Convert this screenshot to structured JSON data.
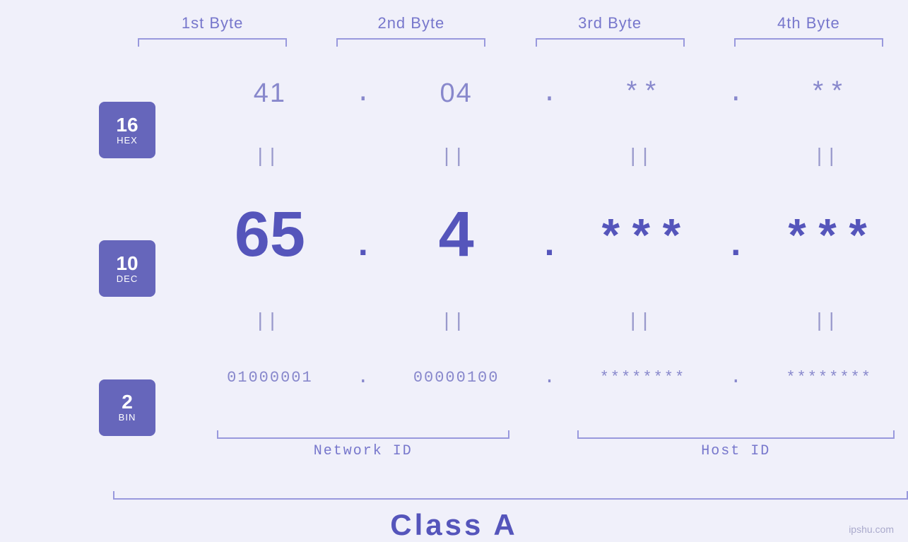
{
  "headers": {
    "byte1": "1st Byte",
    "byte2": "2nd Byte",
    "byte3": "3rd Byte",
    "byte4": "4th Byte"
  },
  "badges": {
    "hex": {
      "num": "16",
      "label": "HEX"
    },
    "dec": {
      "num": "10",
      "label": "DEC"
    },
    "bin": {
      "num": "2",
      "label": "BIN"
    }
  },
  "hex_row": {
    "b1": "41",
    "b2": "04",
    "b3": "**",
    "b4": "**",
    "dot": "."
  },
  "dec_row": {
    "b1": "65",
    "b2": "4",
    "b3": "***",
    "b4": "***",
    "dot": "."
  },
  "bin_row": {
    "b1": "01000001",
    "b2": "00000100",
    "b3": "********",
    "b4": "********",
    "dot": "."
  },
  "labels": {
    "network_id": "Network ID",
    "host_id": "Host ID",
    "class": "Class A"
  },
  "watermark": "ipshu.com"
}
